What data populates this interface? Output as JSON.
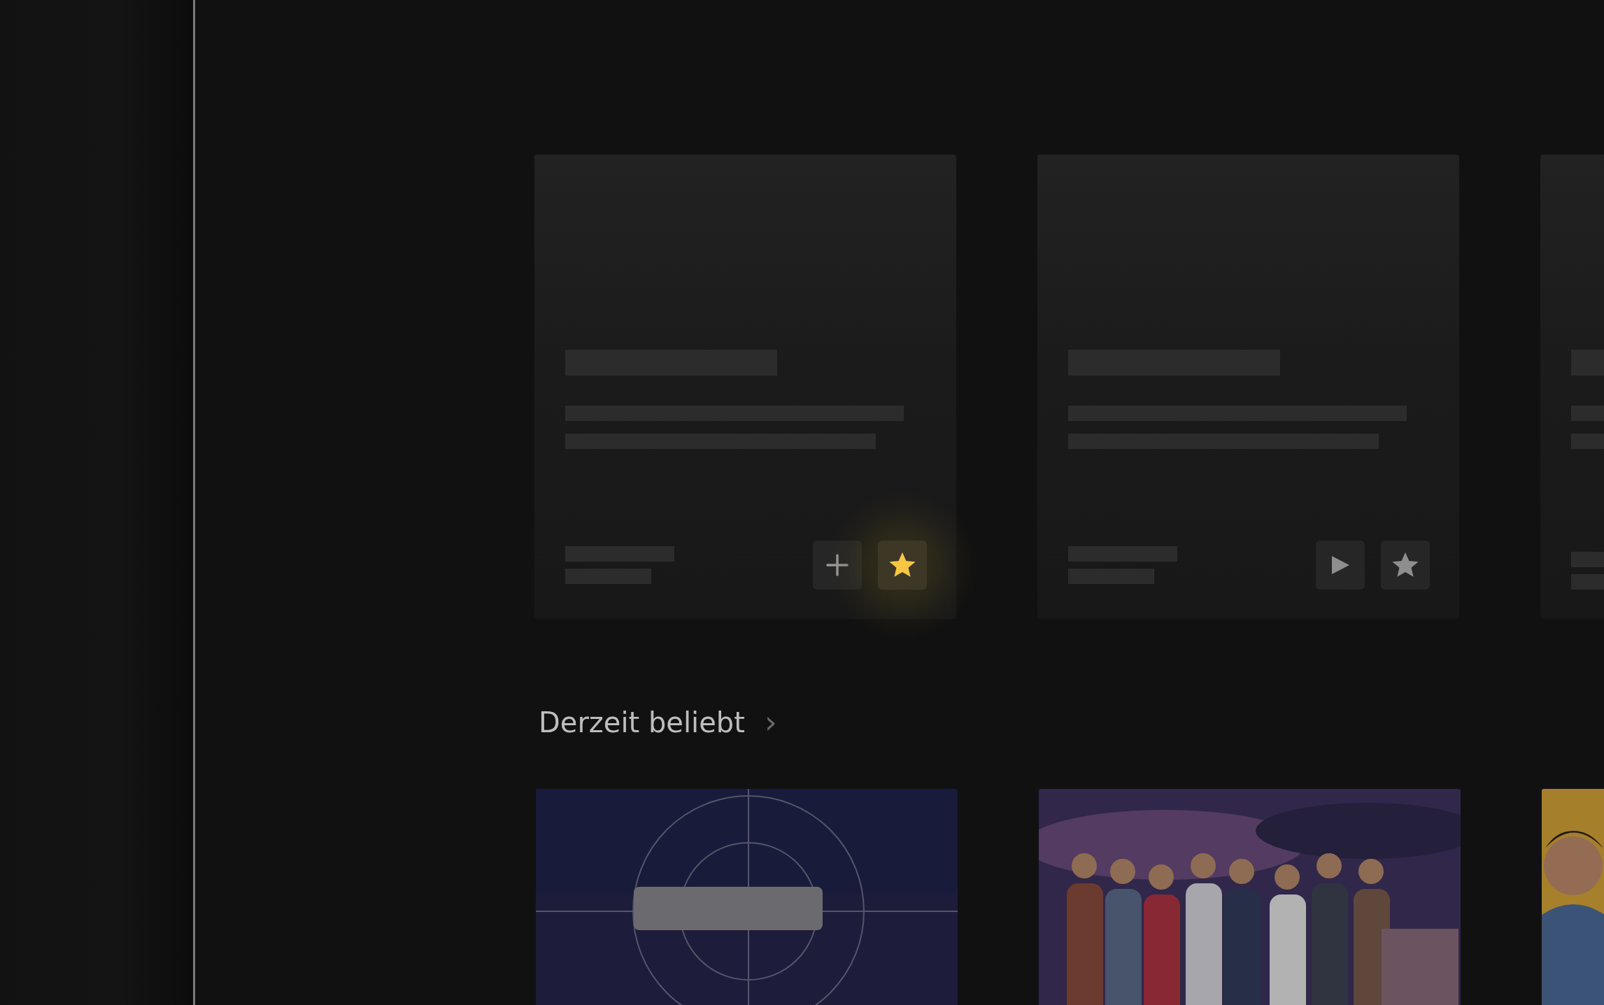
{
  "cards": [
    {
      "kind": "skeleton",
      "buttons": [
        {
          "kind": "add",
          "focused": false
        },
        {
          "kind": "favorite",
          "focused": true
        }
      ]
    },
    {
      "kind": "skeleton",
      "buttons": [
        {
          "kind": "play",
          "focused": false
        },
        {
          "kind": "favorite",
          "focused": false
        }
      ]
    },
    {
      "kind": "skeleton"
    }
  ],
  "section": {
    "title": "Derzeit beliebt",
    "chevron": "›"
  }
}
